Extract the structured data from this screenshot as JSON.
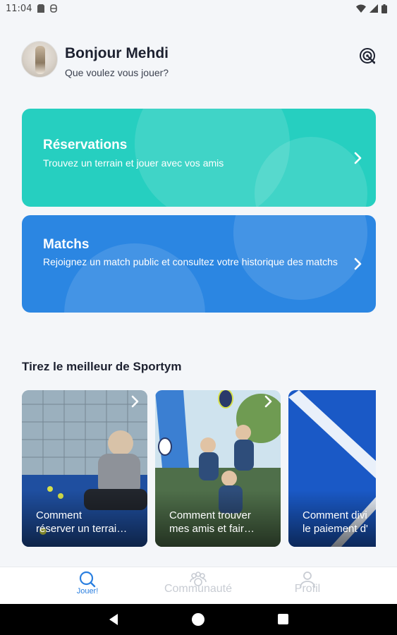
{
  "status_bar": {
    "time": "11:04",
    "icons": [
      "sd-card-icon",
      "sync-icon",
      "wifi-icon",
      "signal-icon",
      "battery-icon"
    ]
  },
  "header": {
    "greeting": "Bonjour Mehdi",
    "subtitle": "Que voulez vous jouer?",
    "action_icon": "target-icon"
  },
  "cards": {
    "reservations": {
      "title": "Réservations",
      "description": "Trouvez un terrain et jouer avec vos amis",
      "color": "#26cfc0"
    },
    "matchs": {
      "title": "Matchs",
      "description": "Rejoignez un match public et consultez votre historique des matchs",
      "color": "#2b86e2"
    }
  },
  "tips": {
    "section_title": "Tirez le meilleur de Sportym",
    "items": [
      {
        "label": "Comment\nréserver un terrai…"
      },
      {
        "label": "Comment trouver\nmes amis et fair…"
      },
      {
        "label": "Comment divi\nle paiement d'"
      }
    ]
  },
  "bottom_nav": {
    "items": [
      {
        "label": "Jouer!",
        "icon": "search-icon",
        "active": true
      },
      {
        "label": "Communauté",
        "icon": "community-icon",
        "active": false
      },
      {
        "label": "Profil",
        "icon": "profile-icon",
        "active": false
      }
    ],
    "active_color": "#2a7fe0",
    "inactive_color": "#c8ccd3"
  }
}
